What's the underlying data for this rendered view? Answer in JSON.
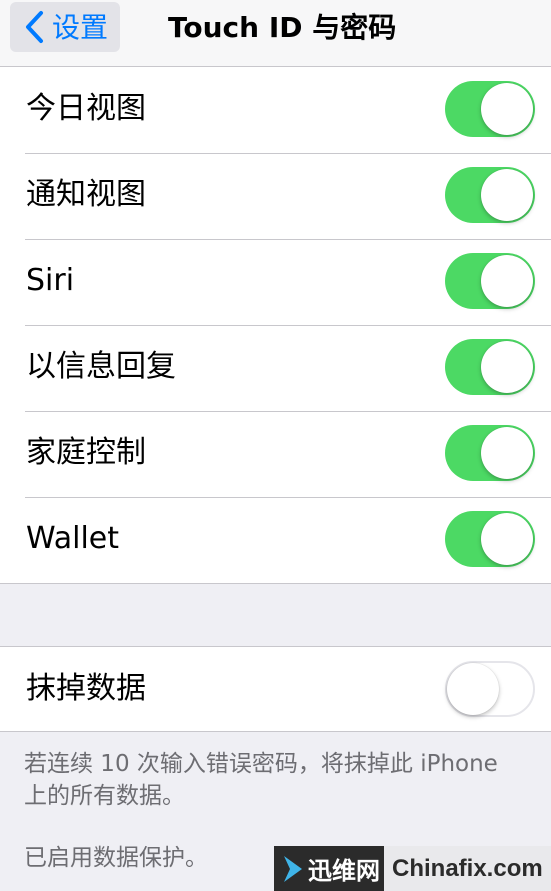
{
  "navbar": {
    "back_label": "设置",
    "title": "Touch ID 与密码"
  },
  "group1": {
    "rows": [
      {
        "label": "今日视图",
        "toggle": "on"
      },
      {
        "label": "通知视图",
        "toggle": "on"
      },
      {
        "label": "Siri",
        "toggle": "on"
      },
      {
        "label": "以信息回复",
        "toggle": "on"
      },
      {
        "label": "家庭控制",
        "toggle": "on"
      },
      {
        "label": "Wallet",
        "toggle": "on"
      }
    ]
  },
  "group2": {
    "rows": [
      {
        "label": "抹掉数据",
        "toggle": "off"
      }
    ]
  },
  "footnotes": {
    "erase_note": "若连续 10 次输入错误密码，将抹掉此 iPhone 上的所有数据。",
    "protection_note": "已启用数据保护。"
  },
  "watermark": {
    "left_text": "迅维网",
    "right_text": "Chinafix.com"
  },
  "colors": {
    "accent": "#007aff",
    "toggle_on": "#4cd964",
    "background": "#efeff4"
  }
}
